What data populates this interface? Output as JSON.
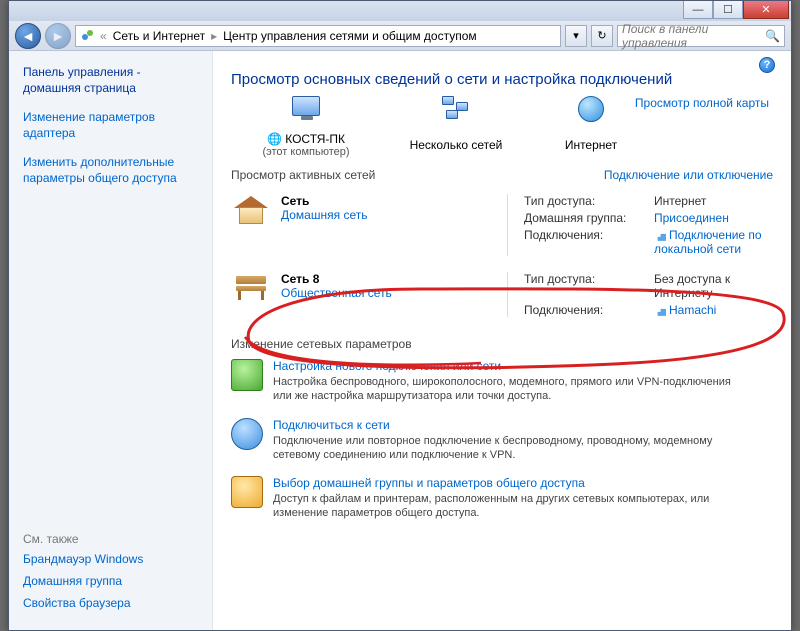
{
  "titlebar": {
    "min": "—",
    "max": "☐",
    "close": "✕"
  },
  "addrbar": {
    "crumb1": "Сеть и Интернет",
    "crumb2": "Центр управления сетями и общим доступом",
    "search_placeholder": "Поиск в панели управления"
  },
  "sidebar": {
    "home": "Панель управления - домашняя страница",
    "link1": "Изменение параметров адаптера",
    "link2": "Изменить дополнительные параметры общего доступа",
    "seealso_label": "См. также",
    "bl1": "Брандмауэр Windows",
    "bl2": "Домашняя группа",
    "bl3": "Свойства браузера"
  },
  "main": {
    "title": "Просмотр основных сведений о сети и настройка подключений",
    "map_link": "Просмотр полной карты",
    "node1": "КОСТЯ-ПК",
    "node1_sub": "(этот компьютер)",
    "node2": "Несколько сетей",
    "node3": "Интернет",
    "active_head": "Просмотр активных сетей",
    "active_link": "Подключение или отключение",
    "net1": {
      "name": "Сеть",
      "type": "Домашняя сеть",
      "k1": "Тип доступа:",
      "v1": "Интернет",
      "k2": "Домашняя группа:",
      "v2": "Присоединен",
      "k3": "Подключения:",
      "v3": "Подключение по локальной сети"
    },
    "net2": {
      "name": "Сеть 8",
      "type": "Общественная сеть",
      "k1": "Тип доступа:",
      "v1": "Без доступа к Интернету",
      "k2": "Подключения:",
      "v2": "Hamachi"
    },
    "tasks_head": "Изменение сетевых параметров",
    "t1_title": "Настройка нового подключения или сети",
    "t1_desc": "Настройка беспроводного, широкополосного, модемного, прямого или VPN-подключения или же настройка маршрутизатора или точки доступа.",
    "t2_title": "Подключиться к сети",
    "t2_desc": "Подключение или повторное подключение к беспроводному, проводному, модемному сетевому соединению или подключение к VPN.",
    "t3_title": "Выбор домашней группы и параметров общего доступа",
    "t3_desc": "Доступ к файлам и принтерам, расположенным на других сетевых компьютерах, или изменение параметров общего доступа."
  }
}
